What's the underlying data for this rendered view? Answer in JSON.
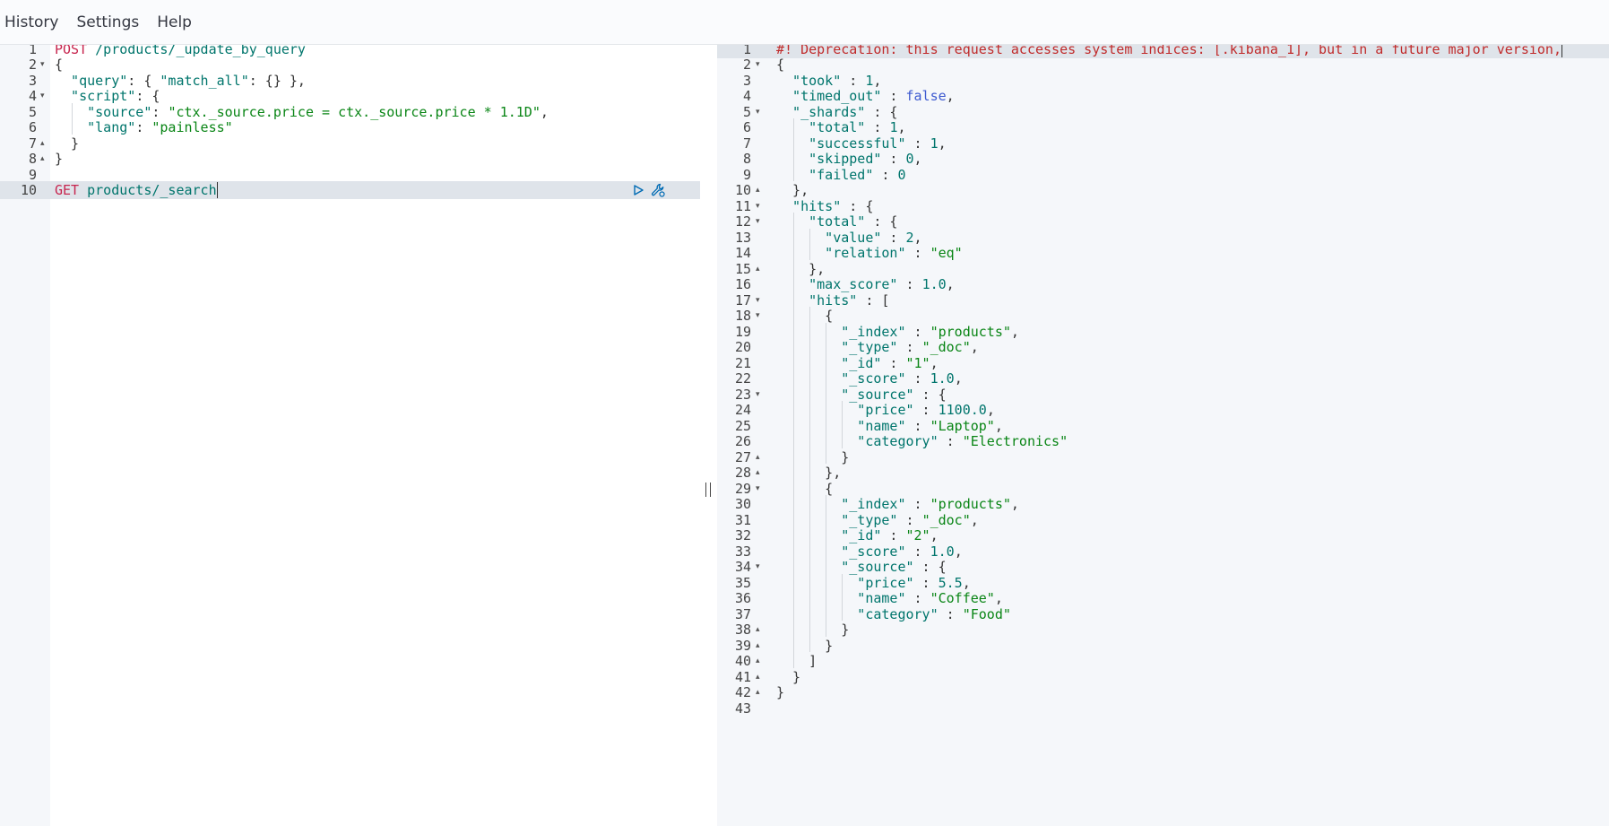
{
  "menu": [
    {
      "id": "history",
      "label": "History"
    },
    {
      "id": "settings",
      "label": "Settings"
    },
    {
      "id": "help",
      "label": "Help"
    }
  ],
  "colors": {
    "accent": "#006bb4",
    "method": "#c7254e",
    "key": "#00756c",
    "string": "#098515",
    "warning": "#c02b2b"
  },
  "request_editor": {
    "active_line": 10,
    "lines": [
      {
        "n": "1",
        "fold": "",
        "tokens": [
          {
            "t": "POST",
            "c": "method"
          },
          {
            "t": " /products/_update_by_query",
            "c": "url"
          }
        ]
      },
      {
        "n": "2",
        "fold": "▾",
        "tokens": [
          {
            "t": "{",
            "c": "punc"
          }
        ]
      },
      {
        "n": "3",
        "fold": "",
        "tokens": [
          {
            "t": "  \"query\"",
            "c": "key"
          },
          {
            "t": ": { ",
            "c": "punc"
          },
          {
            "t": "\"match_all\"",
            "c": "key"
          },
          {
            "t": ": {} },",
            "c": "punc"
          }
        ]
      },
      {
        "n": "4",
        "fold": "▾",
        "tokens": [
          {
            "t": "  \"script\"",
            "c": "key"
          },
          {
            "t": ": {",
            "c": "punc"
          }
        ]
      },
      {
        "n": "5",
        "fold": "",
        "tokens": [
          {
            "t": "    \"source\"",
            "c": "key"
          },
          {
            "t": ": ",
            "c": "punc"
          },
          {
            "t": "\"ctx._source.price = ctx._source.price * 1.1D\"",
            "c": "str"
          },
          {
            "t": ",",
            "c": "punc"
          }
        ]
      },
      {
        "n": "6",
        "fold": "",
        "tokens": [
          {
            "t": "    \"lang\"",
            "c": "key"
          },
          {
            "t": ": ",
            "c": "punc"
          },
          {
            "t": "\"painless\"",
            "c": "str"
          }
        ]
      },
      {
        "n": "7",
        "fold": "▴",
        "tokens": [
          {
            "t": "  }",
            "c": "punc"
          }
        ]
      },
      {
        "n": "8",
        "fold": "▴",
        "tokens": [
          {
            "t": "}",
            "c": "punc"
          }
        ]
      },
      {
        "n": "9",
        "fold": "",
        "tokens": []
      },
      {
        "n": "10",
        "fold": "",
        "tokens": [
          {
            "t": "GET",
            "c": "method"
          },
          {
            "t": " products/_search",
            "c": "url"
          }
        ]
      }
    ]
  },
  "response": {
    "lines": [
      {
        "n": "1",
        "fold": "",
        "tokens": [
          {
            "t": "#! Deprecation: this request accesses system indices: [.kibana_1], but in a future major version,",
            "c": "warn"
          }
        ]
      },
      {
        "n": "2",
        "fold": "▾",
        "tokens": [
          {
            "t": "{",
            "c": "punc"
          }
        ]
      },
      {
        "n": "3",
        "fold": "",
        "tokens": [
          {
            "t": "  \"took\"",
            "c": "key"
          },
          {
            "t": " : ",
            "c": "punc"
          },
          {
            "t": "1",
            "c": "num"
          },
          {
            "t": ",",
            "c": "punc"
          }
        ]
      },
      {
        "n": "4",
        "fold": "",
        "tokens": [
          {
            "t": "  \"timed_out\"",
            "c": "key"
          },
          {
            "t": " : ",
            "c": "punc"
          },
          {
            "t": "false",
            "c": "bool"
          },
          {
            "t": ",",
            "c": "punc"
          }
        ]
      },
      {
        "n": "5",
        "fold": "▾",
        "tokens": [
          {
            "t": "  \"_shards\"",
            "c": "key"
          },
          {
            "t": " : {",
            "c": "punc"
          }
        ]
      },
      {
        "n": "6",
        "fold": "",
        "tokens": [
          {
            "t": "    \"total\"",
            "c": "key"
          },
          {
            "t": " : ",
            "c": "punc"
          },
          {
            "t": "1",
            "c": "num"
          },
          {
            "t": ",",
            "c": "punc"
          }
        ]
      },
      {
        "n": "7",
        "fold": "",
        "tokens": [
          {
            "t": "    \"successful\"",
            "c": "key"
          },
          {
            "t": " : ",
            "c": "punc"
          },
          {
            "t": "1",
            "c": "num"
          },
          {
            "t": ",",
            "c": "punc"
          }
        ]
      },
      {
        "n": "8",
        "fold": "",
        "tokens": [
          {
            "t": "    \"skipped\"",
            "c": "key"
          },
          {
            "t": " : ",
            "c": "punc"
          },
          {
            "t": "0",
            "c": "num"
          },
          {
            "t": ",",
            "c": "punc"
          }
        ]
      },
      {
        "n": "9",
        "fold": "",
        "tokens": [
          {
            "t": "    \"failed\"",
            "c": "key"
          },
          {
            "t": " : ",
            "c": "punc"
          },
          {
            "t": "0",
            "c": "num"
          }
        ]
      },
      {
        "n": "10",
        "fold": "▴",
        "tokens": [
          {
            "t": "  },",
            "c": "punc"
          }
        ]
      },
      {
        "n": "11",
        "fold": "▾",
        "tokens": [
          {
            "t": "  \"hits\"",
            "c": "key"
          },
          {
            "t": " : {",
            "c": "punc"
          }
        ]
      },
      {
        "n": "12",
        "fold": "▾",
        "tokens": [
          {
            "t": "    \"total\"",
            "c": "key"
          },
          {
            "t": " : {",
            "c": "punc"
          }
        ]
      },
      {
        "n": "13",
        "fold": "",
        "tokens": [
          {
            "t": "      \"value\"",
            "c": "key"
          },
          {
            "t": " : ",
            "c": "punc"
          },
          {
            "t": "2",
            "c": "num"
          },
          {
            "t": ",",
            "c": "punc"
          }
        ]
      },
      {
        "n": "14",
        "fold": "",
        "tokens": [
          {
            "t": "      \"relation\"",
            "c": "key"
          },
          {
            "t": " : ",
            "c": "punc"
          },
          {
            "t": "\"eq\"",
            "c": "str"
          }
        ]
      },
      {
        "n": "15",
        "fold": "▴",
        "tokens": [
          {
            "t": "    },",
            "c": "punc"
          }
        ]
      },
      {
        "n": "16",
        "fold": "",
        "tokens": [
          {
            "t": "    \"max_score\"",
            "c": "key"
          },
          {
            "t": " : ",
            "c": "punc"
          },
          {
            "t": "1.0",
            "c": "num"
          },
          {
            "t": ",",
            "c": "punc"
          }
        ]
      },
      {
        "n": "17",
        "fold": "▾",
        "tokens": [
          {
            "t": "    \"hits\"",
            "c": "key"
          },
          {
            "t": " : [",
            "c": "punc"
          }
        ]
      },
      {
        "n": "18",
        "fold": "▾",
        "tokens": [
          {
            "t": "      {",
            "c": "punc"
          }
        ]
      },
      {
        "n": "19",
        "fold": "",
        "tokens": [
          {
            "t": "        \"_index\"",
            "c": "key"
          },
          {
            "t": " : ",
            "c": "punc"
          },
          {
            "t": "\"products\"",
            "c": "str"
          },
          {
            "t": ",",
            "c": "punc"
          }
        ]
      },
      {
        "n": "20",
        "fold": "",
        "tokens": [
          {
            "t": "        \"_type\"",
            "c": "key"
          },
          {
            "t": " : ",
            "c": "punc"
          },
          {
            "t": "\"_doc\"",
            "c": "str"
          },
          {
            "t": ",",
            "c": "punc"
          }
        ]
      },
      {
        "n": "21",
        "fold": "",
        "tokens": [
          {
            "t": "        \"_id\"",
            "c": "key"
          },
          {
            "t": " : ",
            "c": "punc"
          },
          {
            "t": "\"1\"",
            "c": "str"
          },
          {
            "t": ",",
            "c": "punc"
          }
        ]
      },
      {
        "n": "22",
        "fold": "",
        "tokens": [
          {
            "t": "        \"_score\"",
            "c": "key"
          },
          {
            "t": " : ",
            "c": "punc"
          },
          {
            "t": "1.0",
            "c": "num"
          },
          {
            "t": ",",
            "c": "punc"
          }
        ]
      },
      {
        "n": "23",
        "fold": "▾",
        "tokens": [
          {
            "t": "        \"_source\"",
            "c": "key"
          },
          {
            "t": " : {",
            "c": "punc"
          }
        ]
      },
      {
        "n": "24",
        "fold": "",
        "tokens": [
          {
            "t": "          \"price\"",
            "c": "key"
          },
          {
            "t": " : ",
            "c": "punc"
          },
          {
            "t": "1100.0",
            "c": "num"
          },
          {
            "t": ",",
            "c": "punc"
          }
        ]
      },
      {
        "n": "25",
        "fold": "",
        "tokens": [
          {
            "t": "          \"name\"",
            "c": "key"
          },
          {
            "t": " : ",
            "c": "punc"
          },
          {
            "t": "\"Laptop\"",
            "c": "str"
          },
          {
            "t": ",",
            "c": "punc"
          }
        ]
      },
      {
        "n": "26",
        "fold": "",
        "tokens": [
          {
            "t": "          \"category\"",
            "c": "key"
          },
          {
            "t": " : ",
            "c": "punc"
          },
          {
            "t": "\"Electronics\"",
            "c": "str"
          }
        ]
      },
      {
        "n": "27",
        "fold": "▴",
        "tokens": [
          {
            "t": "        }",
            "c": "punc"
          }
        ]
      },
      {
        "n": "28",
        "fold": "▴",
        "tokens": [
          {
            "t": "      },",
            "c": "punc"
          }
        ]
      },
      {
        "n": "29",
        "fold": "▾",
        "tokens": [
          {
            "t": "      {",
            "c": "punc"
          }
        ]
      },
      {
        "n": "30",
        "fold": "",
        "tokens": [
          {
            "t": "        \"_index\"",
            "c": "key"
          },
          {
            "t": " : ",
            "c": "punc"
          },
          {
            "t": "\"products\"",
            "c": "str"
          },
          {
            "t": ",",
            "c": "punc"
          }
        ]
      },
      {
        "n": "31",
        "fold": "",
        "tokens": [
          {
            "t": "        \"_type\"",
            "c": "key"
          },
          {
            "t": " : ",
            "c": "punc"
          },
          {
            "t": "\"_doc\"",
            "c": "str"
          },
          {
            "t": ",",
            "c": "punc"
          }
        ]
      },
      {
        "n": "32",
        "fold": "",
        "tokens": [
          {
            "t": "        \"_id\"",
            "c": "key"
          },
          {
            "t": " : ",
            "c": "punc"
          },
          {
            "t": "\"2\"",
            "c": "str"
          },
          {
            "t": ",",
            "c": "punc"
          }
        ]
      },
      {
        "n": "33",
        "fold": "",
        "tokens": [
          {
            "t": "        \"_score\"",
            "c": "key"
          },
          {
            "t": " : ",
            "c": "punc"
          },
          {
            "t": "1.0",
            "c": "num"
          },
          {
            "t": ",",
            "c": "punc"
          }
        ]
      },
      {
        "n": "34",
        "fold": "▾",
        "tokens": [
          {
            "t": "        \"_source\"",
            "c": "key"
          },
          {
            "t": " : {",
            "c": "punc"
          }
        ]
      },
      {
        "n": "35",
        "fold": "",
        "tokens": [
          {
            "t": "          \"price\"",
            "c": "key"
          },
          {
            "t": " : ",
            "c": "punc"
          },
          {
            "t": "5.5",
            "c": "num"
          },
          {
            "t": ",",
            "c": "punc"
          }
        ]
      },
      {
        "n": "36",
        "fold": "",
        "tokens": [
          {
            "t": "          \"name\"",
            "c": "key"
          },
          {
            "t": " : ",
            "c": "punc"
          },
          {
            "t": "\"Coffee\"",
            "c": "str"
          },
          {
            "t": ",",
            "c": "punc"
          }
        ]
      },
      {
        "n": "37",
        "fold": "",
        "tokens": [
          {
            "t": "          \"category\"",
            "c": "key"
          },
          {
            "t": " : ",
            "c": "punc"
          },
          {
            "t": "\"Food\"",
            "c": "str"
          }
        ]
      },
      {
        "n": "38",
        "fold": "▴",
        "tokens": [
          {
            "t": "        }",
            "c": "punc"
          }
        ]
      },
      {
        "n": "39",
        "fold": "▴",
        "tokens": [
          {
            "t": "      }",
            "c": "punc"
          }
        ]
      },
      {
        "n": "40",
        "fold": "▴",
        "tokens": [
          {
            "t": "    ]",
            "c": "punc"
          }
        ]
      },
      {
        "n": "41",
        "fold": "▴",
        "tokens": [
          {
            "t": "  }",
            "c": "punc"
          }
        ]
      },
      {
        "n": "42",
        "fold": "▴",
        "tokens": [
          {
            "t": "}",
            "c": "punc"
          }
        ]
      },
      {
        "n": "43",
        "fold": "",
        "tokens": []
      }
    ]
  },
  "icons": {
    "run": "play-icon",
    "settings": "wrench-icon",
    "resize": "double-bar-icon"
  }
}
